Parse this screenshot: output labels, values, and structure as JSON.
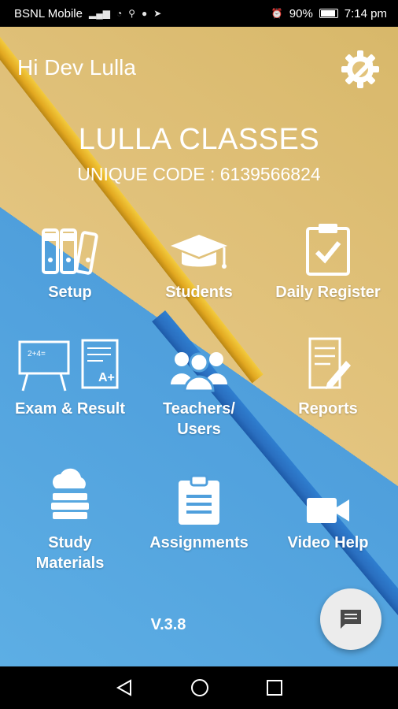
{
  "status": {
    "carrier": "BSNL Mobile",
    "battery": "90%",
    "time": "7:14 pm"
  },
  "header": {
    "greeting": "Hi Dev Lulla",
    "settings_icon": "gear-wrench-icon"
  },
  "institute": {
    "name": "LULLA CLASSES",
    "unique_code": "UNIQUE CODE : 6139566824"
  },
  "menu": {
    "setup": "Setup",
    "students": "Students",
    "daily_register": "Daily Register",
    "exam_result": "Exam & Result",
    "teachers_line1": "Teachers/",
    "teachers_line2": "Users",
    "reports": "Reports",
    "study_line1": "Study",
    "study_line2": "Materials",
    "assignments": "Assignments",
    "video_help": "Video Help"
  },
  "footer": {
    "version": "V.3.8"
  },
  "colors": {
    "blue_bg": "#4f9fdc",
    "yellow_bg": "#e2c37c",
    "fab_bg": "#ececec"
  }
}
